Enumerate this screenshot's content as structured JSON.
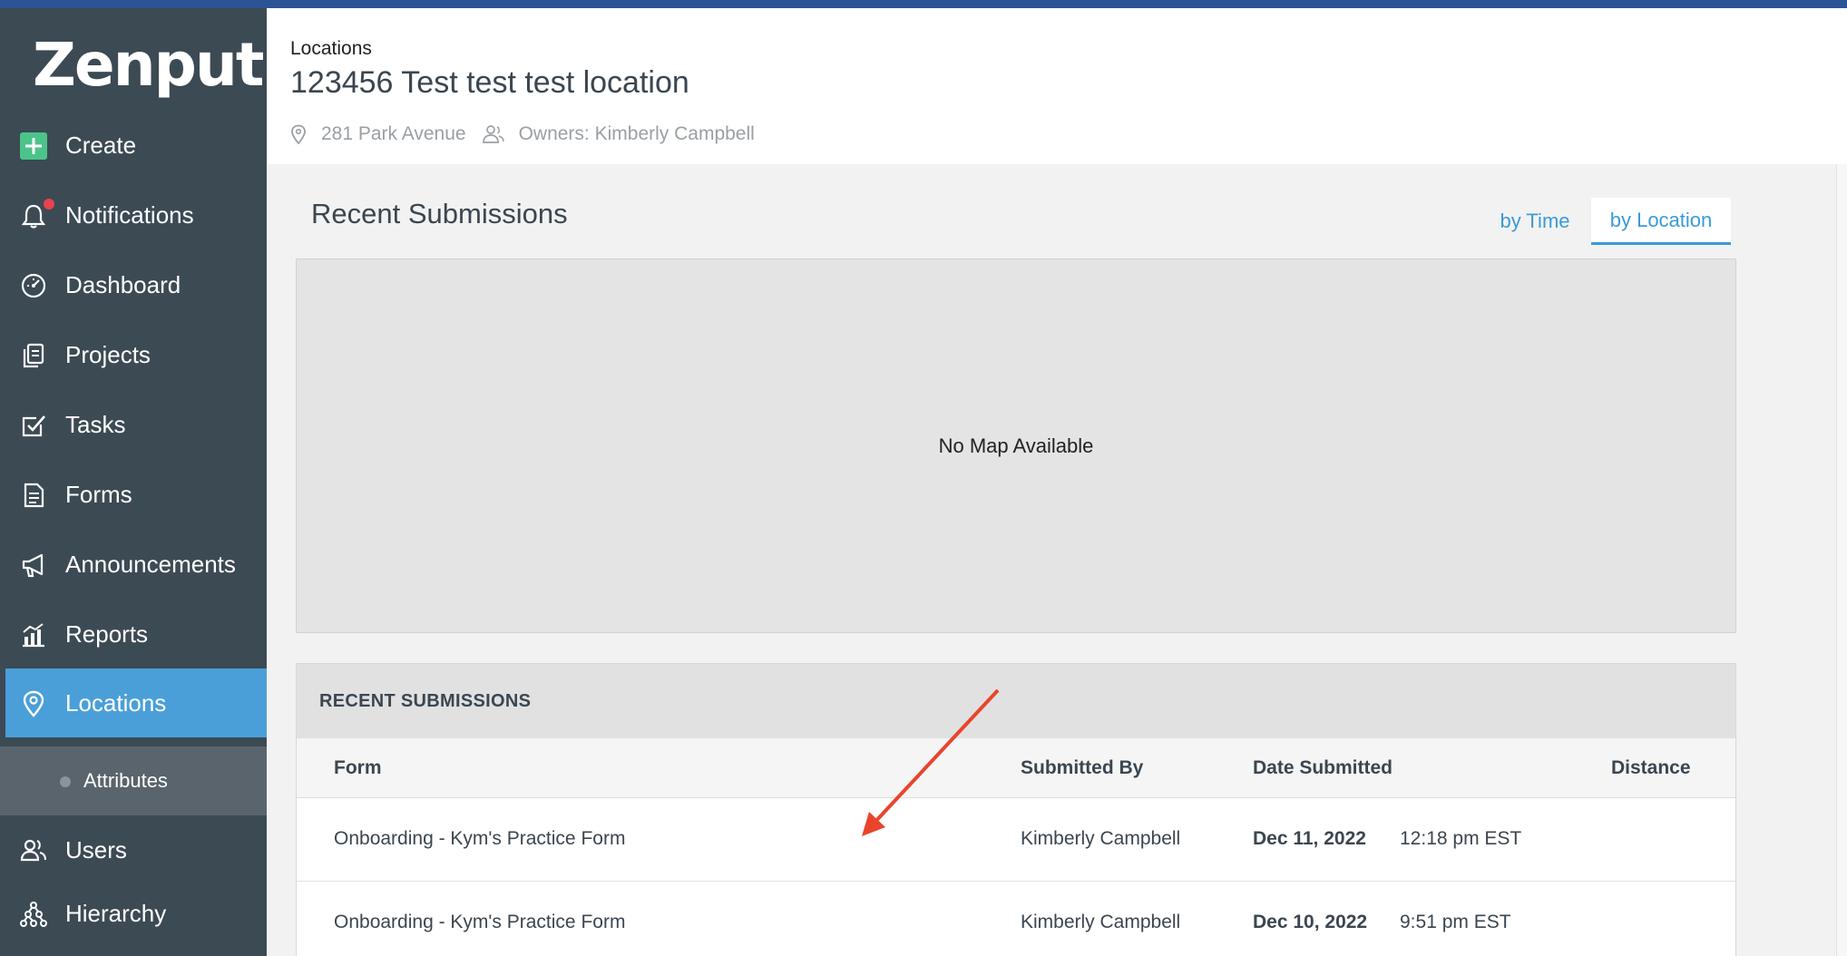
{
  "app": {
    "logo_text": "Zenput."
  },
  "sidebar": {
    "items": [
      {
        "label": "Create",
        "icon": "plus-icon"
      },
      {
        "label": "Notifications",
        "icon": "bell-icon"
      },
      {
        "label": "Dashboard",
        "icon": "gauge-icon"
      },
      {
        "label": "Projects",
        "icon": "projects-icon"
      },
      {
        "label": "Tasks",
        "icon": "checkbox-icon"
      },
      {
        "label": "Forms",
        "icon": "document-icon"
      },
      {
        "label": "Announcements",
        "icon": "megaphone-icon"
      },
      {
        "label": "Reports",
        "icon": "bar-chart-icon"
      },
      {
        "label": "Locations",
        "icon": "map-pin-icon",
        "active": true
      },
      {
        "label": "Users",
        "icon": "users-icon"
      },
      {
        "label": "Hierarchy",
        "icon": "hierarchy-icon"
      }
    ],
    "sub_items": [
      {
        "label": "Attributes"
      }
    ]
  },
  "header": {
    "breadcrumb": "Locations",
    "title": "123456 Test test test location",
    "address": "281 Park Avenue",
    "owners": "Owners: Kimberly Campbell"
  },
  "main": {
    "section_title": "Recent Submissions",
    "tabs": [
      {
        "label": "by Time",
        "selected": false
      },
      {
        "label": "by Location",
        "selected": true
      }
    ],
    "map_placeholder": "No Map Available",
    "table": {
      "title": "RECENT SUBMISSIONS",
      "columns": [
        "Form",
        "Submitted By",
        "Date Submitted",
        "Distance"
      ],
      "rows": [
        {
          "form": "Onboarding - Kym's Practice Form",
          "submitted_by": "Kimberly Campbell",
          "date": "Dec 11, 2022",
          "time": "12:18 pm EST",
          "distance": ""
        },
        {
          "form": "Onboarding - Kym's Practice Form",
          "submitted_by": "Kimberly Campbell",
          "date": "Dec 10, 2022",
          "time": "9:51 pm EST",
          "distance": ""
        }
      ]
    }
  },
  "colors": {
    "sidebar_bg": "#3c4a54",
    "active_bg": "#4a9fd8",
    "accent": "#3a9ad9",
    "create_green": "#4cc38a",
    "badge_red": "#e8434e",
    "annotation_arrow": "#e8452c"
  }
}
